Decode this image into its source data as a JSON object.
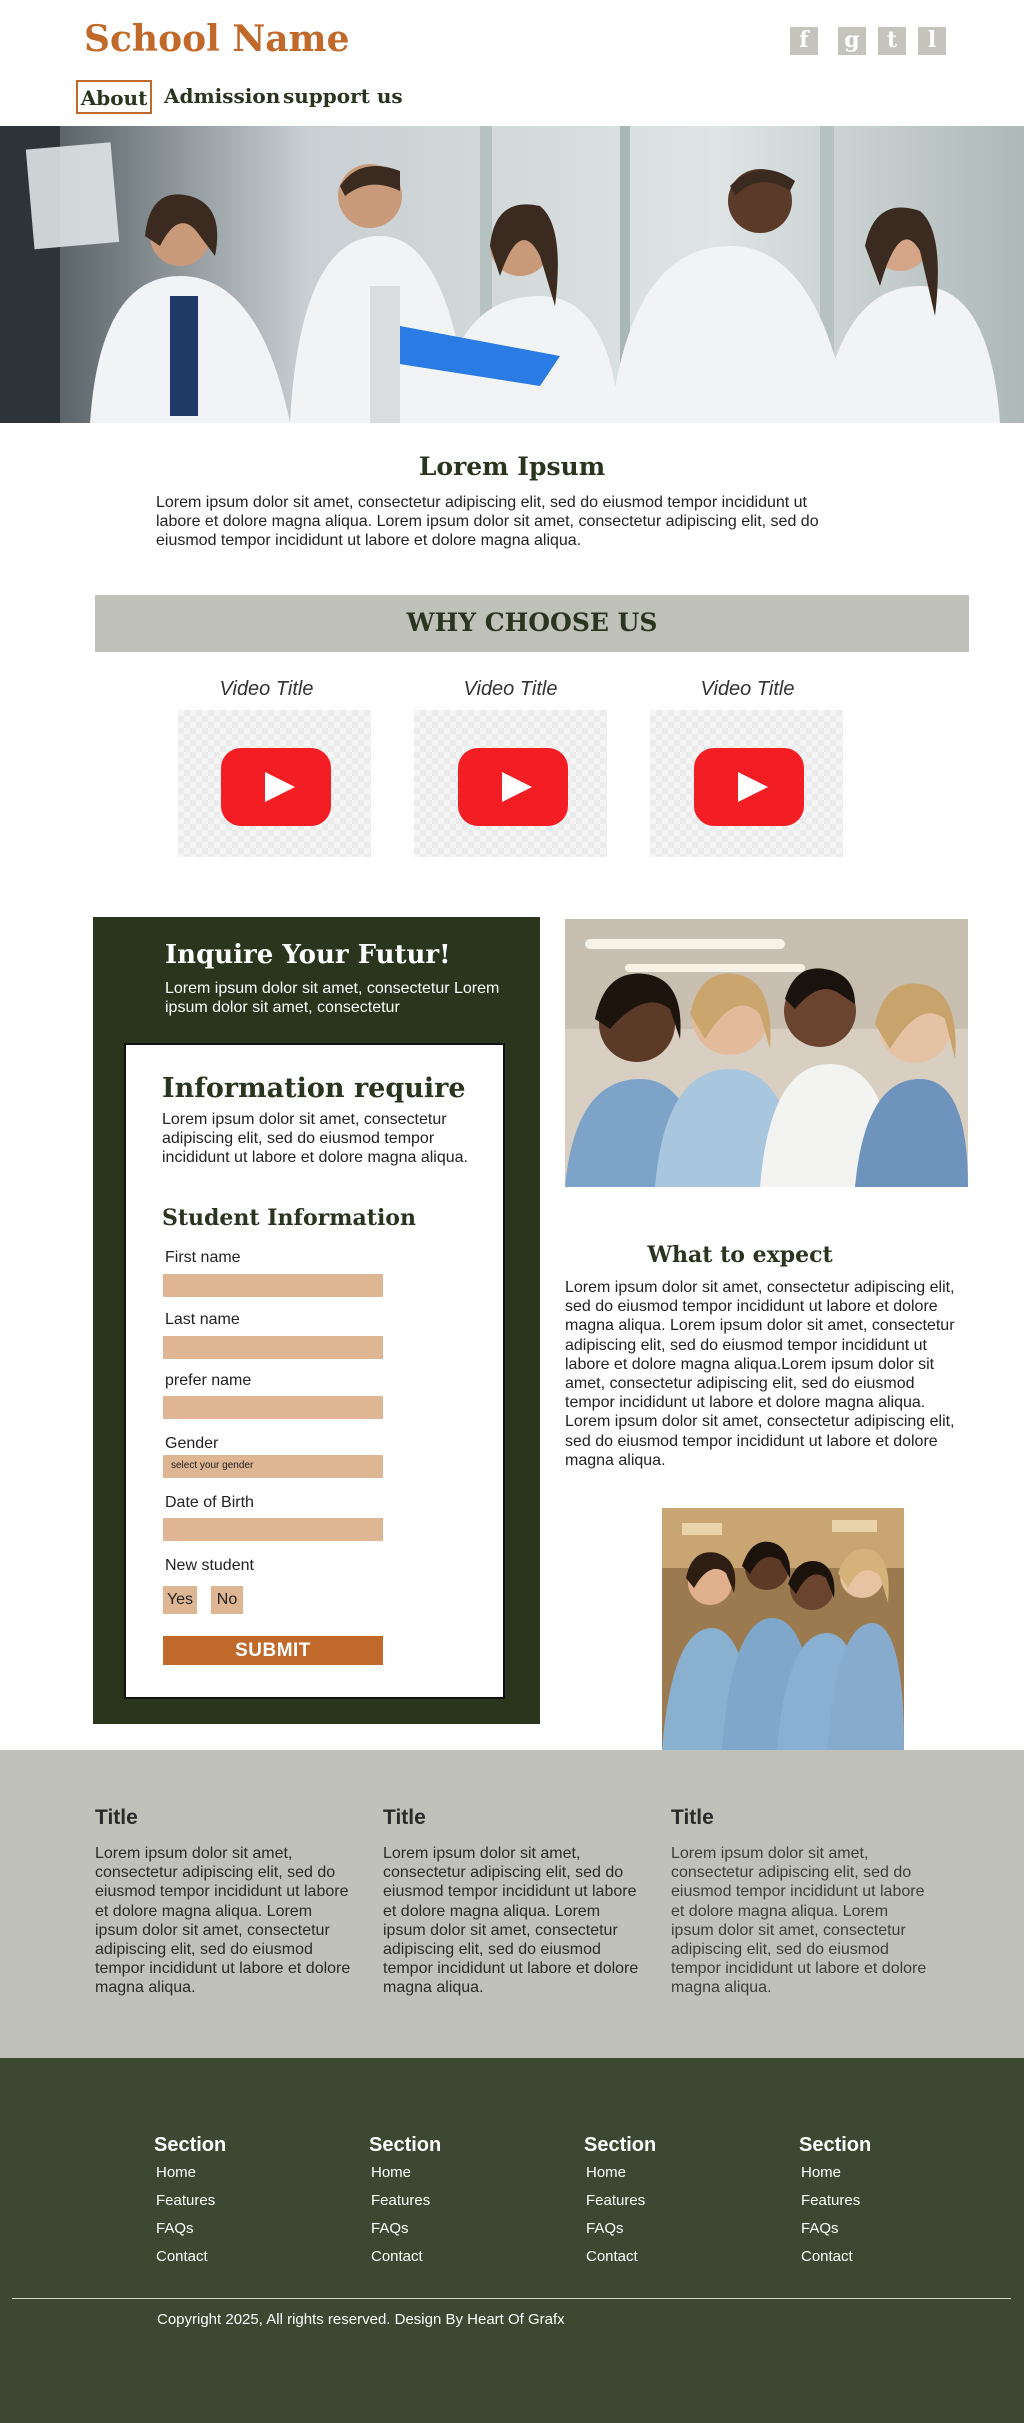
{
  "header": {
    "school_name": "School Name",
    "social": [
      {
        "label": "f",
        "icon": "facebook-icon"
      },
      {
        "label": "g",
        "icon": "google-icon"
      },
      {
        "label": "t",
        "icon": "twitter-icon"
      },
      {
        "label": "l",
        "icon": "linkedin-icon"
      }
    ],
    "nav": [
      {
        "label": "About",
        "active": true
      },
      {
        "label": "Admission"
      },
      {
        "label": "support us"
      }
    ]
  },
  "intro": {
    "title": "Lorem Ipsum",
    "text": "Lorem ipsum dolor sit amet, consectetur adipiscing elit, sed do eiusmod tempor incididunt ut labore et dolore magna aliqua. Lorem ipsum dolor sit amet, consectetur adipiscing elit, sed do eiusmod tempor incididunt ut labore et dolore magna aliqua."
  },
  "why": {
    "title": "WHY CHOOSE US",
    "videos": [
      {
        "title": "Video Title"
      },
      {
        "title": "Video Title"
      },
      {
        "title": "Video Title"
      }
    ]
  },
  "inquire": {
    "title": "Inquire Your Futur!",
    "subtitle": "Lorem ipsum dolor sit amet, consectetur Lorem ipsum dolor sit amet, consectetur",
    "form_title": "Information require",
    "form_text": "Lorem ipsum dolor sit amet, consectetur adipiscing elit, sed do eiusmod tempor incididunt ut labore et dolore magna aliqua.",
    "student_title": "Student Information",
    "first_name": "First name",
    "last_name": "Last name",
    "prefer_name": "prefer name",
    "gender": "Gender",
    "gender_placeholder": "select your gender",
    "dob": "Date of Birth",
    "new_student": "New student",
    "yes": "Yes",
    "no": "No",
    "submit": "SUBMIT"
  },
  "expect": {
    "title": "What to expect",
    "text": "Lorem ipsum dolor sit amet, consectetur adipiscing elit, sed do eiusmod tempor incididunt ut labore et dolore magna aliqua. Lorem ipsum dolor sit amet, consectetur adipiscing elit, sed do eiusmod tempor incididunt ut labore et dolore magna aliqua.Lorem ipsum dolor sit amet, consectetur adipiscing elit, sed do eiusmod tempor incididunt ut labore et dolore magna aliqua. Lorem ipsum dolor sit amet, consectetur adipiscing elit, sed do eiusmod tempor incididunt ut labore et dolore magna aliqua."
  },
  "band": [
    {
      "title": "Title",
      "text": "Lorem ipsum dolor sit amet, consectetur adipiscing elit, sed do eiusmod tempor incididunt ut labore et dolore magna aliqua. Lorem ipsum dolor sit amet, consectetur adipiscing elit, sed do eiusmod tempor incididunt ut labore et dolore magna aliqua."
    },
    {
      "title": "Title",
      "text": "Lorem ipsum dolor sit amet, consectetur adipiscing elit, sed do eiusmod tempor incididunt ut labore et dolore magna aliqua. Lorem ipsum dolor sit amet, consectetur adipiscing elit, sed do eiusmod tempor incididunt ut labore et dolore magna aliqua."
    },
    {
      "title": "Title",
      "text": "Lorem ipsum dolor sit amet, consectetur adipiscing elit, sed do eiusmod tempor incididunt ut labore et dolore magna aliqua. Lorem ipsum dolor sit amet, consectetur adipiscing elit, sed do eiusmod tempor incididunt ut labore et dolore magna aliqua."
    }
  ],
  "footer": {
    "sections": [
      {
        "title": "Section",
        "links": [
          "Home",
          "Features",
          "FAQs",
          "Contact"
        ]
      },
      {
        "title": "Section",
        "links": [
          "Home",
          "Features",
          "FAQs",
          "Contact"
        ]
      },
      {
        "title": "Section",
        "links": [
          "Home",
          "Features",
          "FAQs",
          "Contact"
        ]
      },
      {
        "title": "Section",
        "links": [
          "Home",
          "Features",
          "FAQs",
          "Contact"
        ]
      }
    ],
    "copyright": "Copyright 2025, All rights reserved. Design By Heart Of Grafx"
  },
  "colors": {
    "brand": "#c0692a",
    "dark_green": "#29351d",
    "footer": "#3d4832",
    "band": "#c0c1b9",
    "field": "#dfb694"
  }
}
